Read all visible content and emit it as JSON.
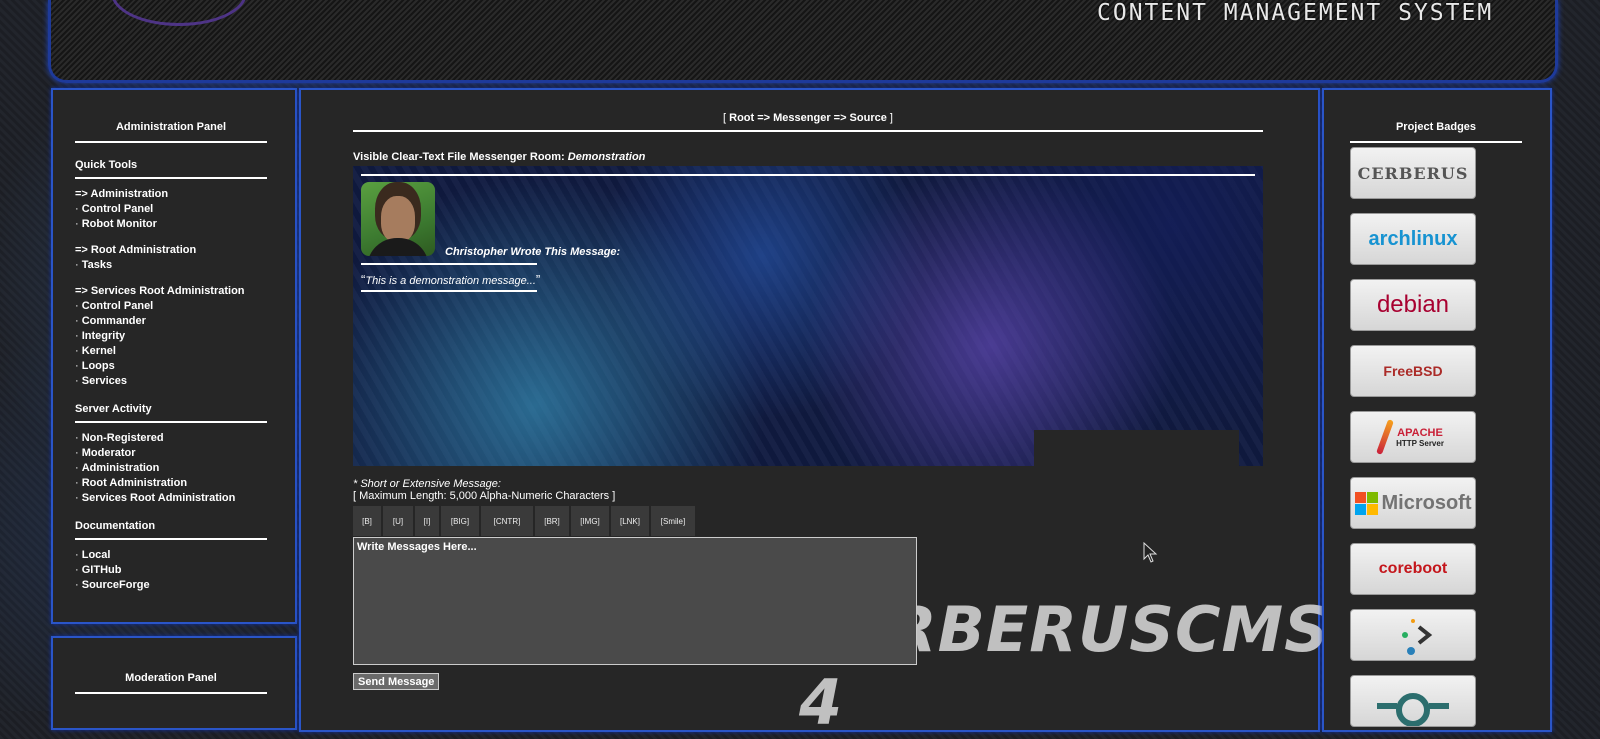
{
  "header": {
    "title": "CONTENT MANAGEMENT SYSTEM"
  },
  "admin_panel": {
    "heading": "Administration Panel",
    "sections": [
      {
        "title": "Quick Tools",
        "groups": [
          [
            {
              "label": "=> Administration",
              "bullet": false
            },
            {
              "label": "Control Panel",
              "bullet": true
            },
            {
              "label": "Robot Monitor",
              "bullet": true
            }
          ],
          [
            {
              "label": "=> Root Administration",
              "bullet": false
            },
            {
              "label": "Tasks",
              "bullet": true
            }
          ],
          [
            {
              "label": "=> Services Root Administration",
              "bullet": false
            },
            {
              "label": "Control Panel",
              "bullet": true
            },
            {
              "label": "Commander",
              "bullet": true
            },
            {
              "label": "Integrity",
              "bullet": true
            },
            {
              "label": "Kernel",
              "bullet": true
            },
            {
              "label": "Loops",
              "bullet": true
            },
            {
              "label": "Services",
              "bullet": true
            }
          ]
        ]
      },
      {
        "title": "Server Activity",
        "groups": [
          [
            {
              "label": "Non-Registered",
              "bullet": true
            },
            {
              "label": "Moderator",
              "bullet": true
            },
            {
              "label": "Administration",
              "bullet": true
            },
            {
              "label": "Root Administration",
              "bullet": true
            },
            {
              "label": "Services Root Administration",
              "bullet": true
            }
          ]
        ]
      },
      {
        "title": "Documentation",
        "groups": [
          [
            {
              "label": "Local",
              "bullet": true
            },
            {
              "label": "GITHub",
              "bullet": true
            },
            {
              "label": "SourceForge",
              "bullet": true
            }
          ]
        ]
      }
    ]
  },
  "moderation_panel": {
    "heading": "Moderation Panel"
  },
  "main": {
    "breadcrumb": {
      "open": "[ ",
      "path": "Root => Messenger => Source",
      "close": " ]"
    },
    "room": {
      "prefix": "Visible Clear-Text File Messenger Room: ",
      "name": "Demonstration"
    },
    "message": {
      "author_line": "Christopher Wrote This Message:",
      "open_quote": "“",
      "text": "This is a demonstration message...",
      "close_quote": "”"
    },
    "compose": {
      "label": "* Short or Extensive Message:",
      "limit": "[ Maximum Length: 5,000 Alpha-Numeric Characters ]",
      "tags": [
        "[B]",
        "[U]",
        "[I]",
        "[BIG]",
        "[CNTR]",
        "[BR]",
        "[IMG]",
        "[LNK]",
        "[Smile]"
      ],
      "placeholder": "Write Messages Here...",
      "send_label": "Send Message"
    },
    "watermark": "CERBERUSCMS 4"
  },
  "badges_panel": {
    "heading": "Project Badges",
    "badges": [
      {
        "name": "cerberus",
        "label": "CERBERUS"
      },
      {
        "name": "archlinux",
        "label": "archlinux"
      },
      {
        "name": "debian",
        "label": "debian"
      },
      {
        "name": "freebsd",
        "label": "FreeBSD"
      },
      {
        "name": "apache",
        "label": "APACHE",
        "sub": "HTTP Server"
      },
      {
        "name": "microsoft",
        "label": "Microsoft"
      },
      {
        "name": "coreboot",
        "label": "coreboot"
      },
      {
        "name": "dots-arrow",
        "label": ""
      },
      {
        "name": "partial",
        "label": ""
      }
    ]
  }
}
